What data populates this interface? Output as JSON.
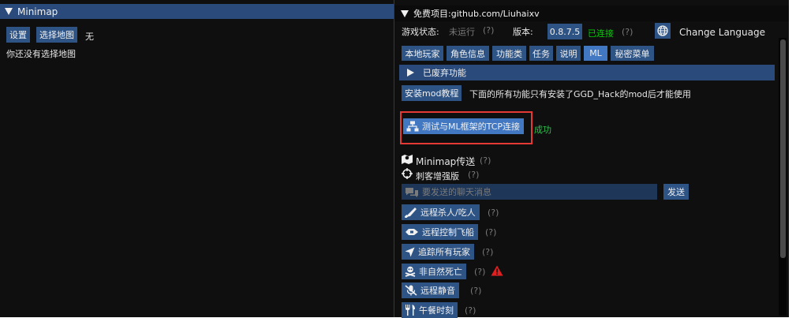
{
  "minimap": {
    "title": "Minimap",
    "settings_button": "设置",
    "select_map_button": "选择地图",
    "selected_map_value": "无",
    "status_text": "你还没有选择地图"
  },
  "main": {
    "title": "免费项目:github.com/Liuhaixv",
    "game_status_label": "游戏状态:",
    "game_status_value": "未运行",
    "game_status_help": "(?)",
    "version_label": "版本:",
    "version_value": "0.8.7.5",
    "connection_value": "已连接",
    "connection_help": "(?)",
    "change_language": "Change Language",
    "tabs": [
      {
        "label": "本地玩家"
      },
      {
        "label": "角色信息"
      },
      {
        "label": "功能类"
      },
      {
        "label": "任务"
      },
      {
        "label": "说明"
      },
      {
        "label": "ML"
      },
      {
        "label": "秘密菜单"
      }
    ],
    "deprecated_section": "已废弃功能",
    "install_mod_button": "安装mod教程",
    "install_mod_note": "下面的所有功能只有安装了GGD_Hack的mod后才能使用",
    "tcp_test_button": "测试与ML框架的TCP连接",
    "tcp_result": "成功",
    "minimap_teleport": "Minimap传送",
    "assassin_enhanced": "刺客增强版",
    "help_mark": "(?)",
    "chat_placeholder": "要发送的聊天消息",
    "send_button": "发送",
    "actions": [
      {
        "label": "远程杀人/吃人",
        "icon": "knife-icon"
      },
      {
        "label": "远程控制飞船",
        "icon": "spaceship-icon"
      },
      {
        "label": "追踪所有玩家",
        "icon": "location-arrow-icon"
      },
      {
        "label": "非自然死亡",
        "icon": "skull-crossbones-icon"
      },
      {
        "label": "远程静音",
        "icon": "mic-slash-icon"
      },
      {
        "label": "午餐时刻",
        "icon": "utensils-icon"
      }
    ],
    "colors": {
      "accent": "#2e5486",
      "title_active": "#294a7a",
      "connected_green": "#00d000",
      "success_green": "#2cc24a",
      "warning_red": "#e02020"
    }
  }
}
